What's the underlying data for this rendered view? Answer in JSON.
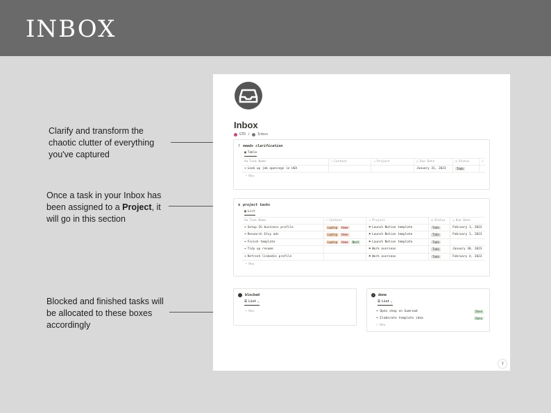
{
  "banner": {
    "title": "INBOX"
  },
  "annotations": {
    "clarify": [
      "Clarify and transform the",
      "chaotic clutter of everything",
      "you've captured"
    ],
    "project_pre_line1": "Once a task in your Inbox has",
    "project_pre_line2": "been assigned to a ",
    "project_bold": "Project",
    "project_post_line2": ", it",
    "project_line3": "will go in this section",
    "blocked": [
      "Blocked and finished tasks will",
      "be allocated to these boxes",
      "accordingly"
    ]
  },
  "page": {
    "title": "Inbox",
    "breadcrumb": {
      "parent": "GTD",
      "separator": "/",
      "current": "Inbox"
    },
    "help_label": "?"
  },
  "clarification": {
    "heading": "needs clarification",
    "heading_glyph": "!",
    "view_label": "Table",
    "columns": [
      "Task Name",
      "Context",
      "Project",
      "Due Date",
      "Status",
      "+"
    ],
    "rows": [
      {
        "task": "Look up job openings in USA",
        "context": [],
        "project": "",
        "due": "January 31, 2023",
        "status": "Todo"
      }
    ],
    "new_label": "+ New"
  },
  "project_tasks": {
    "heading": "project tasks",
    "heading_glyph": "≡",
    "view_label": "List",
    "columns": [
      "Task Name",
      "Context",
      "Project",
      "Status",
      "Due Date"
    ],
    "rows": [
      {
        "task": "Setup IG business profile",
        "context": [
          "Laptop",
          "Home"
        ],
        "project": "Launch Notion template",
        "status": "Todo",
        "due": "February 1, 2023"
      },
      {
        "task": "Research Etsy ads",
        "context": [
          "Laptop",
          "Home"
        ],
        "project": "Launch Notion template",
        "status": "Todo",
        "due": "February 1, 2023"
      },
      {
        "task": "Finish template",
        "context": [
          "Laptop",
          "Home",
          "Next"
        ],
        "project": "Launch Notion template",
        "status": "Todo",
        "due": ""
      },
      {
        "task": "Tidy up resume",
        "context": [],
        "project": "Work overseas",
        "status": "Todo",
        "due": "January 30, 2023"
      },
      {
        "task": "Refresh linkedin profile",
        "context": [],
        "project": "Work overseas",
        "status": "Todo",
        "due": "February 4, 2023"
      }
    ],
    "new_label": "+ New"
  },
  "blocked": {
    "heading": "blocked",
    "view_label": "List",
    "new_label": "+ New"
  },
  "done": {
    "heading": "done",
    "view_label": "List",
    "items": [
      {
        "task": "Open shop on Gumroad",
        "status": "Done"
      },
      {
        "task": "Elaborate template idea",
        "status": "Done"
      }
    ],
    "new_label": "+ New"
  },
  "colors": {
    "banner": "#6a6a6a",
    "background": "#d9d9d9",
    "icon": "#555555",
    "gtd_badge": "#c4477d",
    "todo_tag": "#e3e2e0",
    "done_tag": "#dbeddb"
  }
}
